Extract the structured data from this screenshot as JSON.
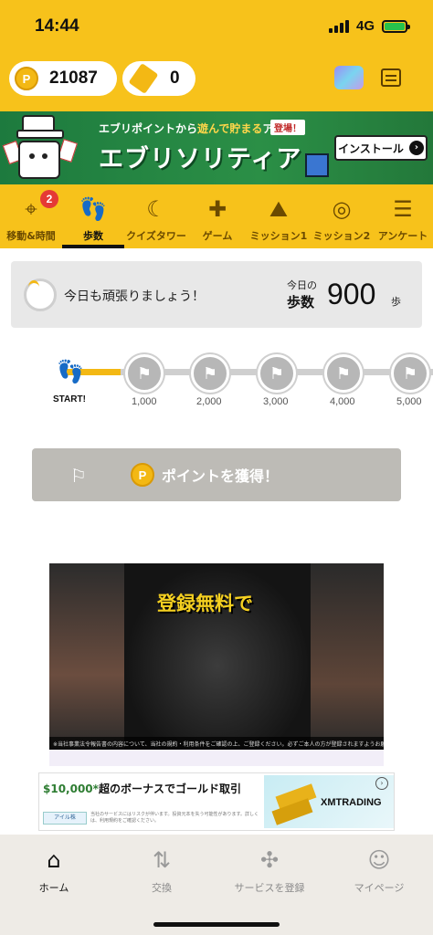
{
  "status_bar": {
    "time": "14:44",
    "network": "4G"
  },
  "header": {
    "points": "21087",
    "tickets": "0",
    "point_icon": "P"
  },
  "banner": {
    "subtitle_pre": "エブリポイントから",
    "subtitle_hl": "遊んで貯まる",
    "subtitle_post": "アプリ",
    "tag": "登場！",
    "title": "エブリソリティア",
    "install_label": "インストール"
  },
  "tabs": [
    {
      "label": "移動&時間",
      "icon": "route-icon",
      "badge": "2"
    },
    {
      "label": "歩数",
      "icon": "footprints-icon",
      "active": true
    },
    {
      "label": "クイズタワー",
      "icon": "moon-icon"
    },
    {
      "label": "ゲーム",
      "icon": "gamepad-icon"
    },
    {
      "label": "ミッション1",
      "icon": "mountain-flag-icon"
    },
    {
      "label": "ミッション2",
      "icon": "target-icon"
    },
    {
      "label": "アンケート",
      "icon": "survey-icon"
    }
  ],
  "steps": {
    "message": "今日も頑張りましょう！",
    "today_label": "今日の",
    "steps_label": "歩数",
    "value": "900",
    "unit": "歩"
  },
  "milestones": {
    "start_label": "START!",
    "items": [
      "1,000",
      "2,000",
      "3,000",
      "4,000",
      "5,000"
    ]
  },
  "get_points": {
    "label": "ポイントを獲得！"
  },
  "video_ad": {
    "caption": "登録無料で",
    "footer_text": "※当社事業法令報告書の内容について、当社の規約・利用条件をご確認の上、ご登録ください。必ずご本人の方が登録されますようお願い申し上げます。"
  },
  "banner_ad": {
    "title_amount": "$10,000*",
    "title_rest": "超のボーナスでゴールド取引",
    "small_logo": "アイル株",
    "small_text": "当社のサービスにはリスクが伴います。投資元本を失う可能性があります。詳しくは、利用規約をご確認ください。",
    "brand": "XMTRADING"
  },
  "bottom_nav": [
    {
      "label": "ホーム",
      "icon": "home-icon",
      "active": true
    },
    {
      "label": "交換",
      "icon": "exchange-icon"
    },
    {
      "label": "サービスを登録",
      "icon": "puzzle-icon"
    },
    {
      "label": "マイページ",
      "icon": "person-icon"
    }
  ],
  "colors": {
    "accent": "#f7c21b",
    "banner_green": "#2b8f46",
    "badge_red": "#e53935"
  }
}
